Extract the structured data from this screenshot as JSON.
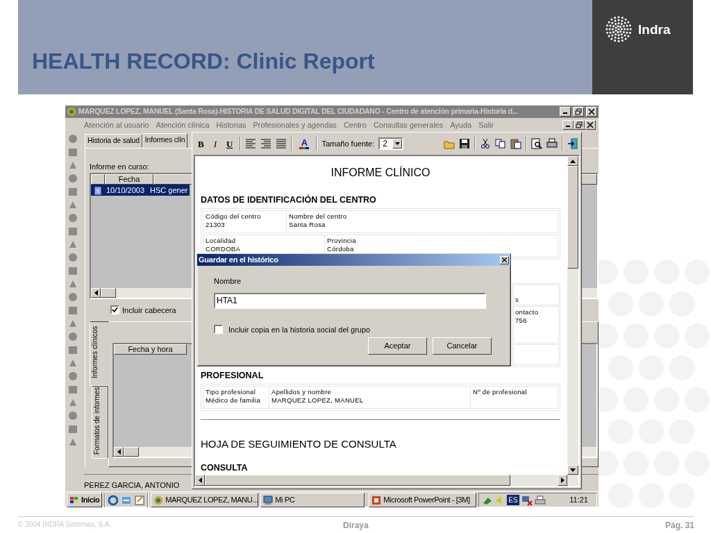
{
  "slide": {
    "title": "HEALTH RECORD: Clinic Report",
    "logo_text": "Indra"
  },
  "app_window": {
    "title": "MARQUEZ LOPEZ, MANUEL (Santa Rosa)-HISTORIA DE SALUD DIGITAL  DEL CIUDADANO - Centro de atención primaria-Historia d...",
    "active": false,
    "menu": [
      "Atención al usuario",
      "Atención clínica",
      "Historias",
      "Profesionales y agendas",
      "Centro",
      "Consultas generales",
      "Ayuda",
      "Salir"
    ],
    "left_panel": {
      "tabs": [
        {
          "label": "Historia de salud",
          "selected": false
        },
        {
          "label": "Informes clín",
          "selected": true
        }
      ],
      "current_label": "Informe en curso:",
      "table": {
        "columns": [
          "Fecha"
        ],
        "rows": [
          {
            "date": "10/10/2003",
            "description": "HSC gener",
            "selected": true
          }
        ]
      },
      "include_header": {
        "label": "Incluir cabecera",
        "checked": true
      },
      "side_tabs": [
        {
          "label": "Informes clínicos",
          "selected": true
        },
        {
          "label": "Formatos de informes",
          "selected": false
        }
      ],
      "list_columns": [
        "Fecha y hora"
      ],
      "patient": "PEREZ GARCIA, ANTONIO"
    }
  },
  "report_editor": {
    "format_buttons": [
      "B",
      "I",
      "U"
    ],
    "font_color_glyph": "A",
    "font_size_label": "Tamaño fuente:",
    "font_size": "2",
    "document": {
      "title": "INFORME CLÍNICO",
      "sections": [
        {
          "kind": "table",
          "heading": "DATOS DE IDENTIFICACIÓN DEL CENTRO",
          "rows": [
            [
              {
                "label": "Código del centro",
                "value": "21303"
              },
              {
                "label": "Nombre del centro",
                "value": "Santa Rosa"
              }
            ],
            [
              {
                "label": "Localidad",
                "value": "CORDOBA"
              },
              {
                "label": "Provincia",
                "value": "Córdoba"
              }
            ]
          ]
        },
        {
          "kind": "obscured",
          "cells": [
            {
              "lines": [
                "s"
              ]
            },
            {
              "lines": [
                "ontacto",
                "756"
              ]
            }
          ]
        },
        {
          "kind": "table",
          "heading": "PROFESIONAL",
          "rows": [
            [
              {
                "label": "Tipo profesional",
                "value": "Médico de familia"
              },
              {
                "label": "Apellidos y nombre",
                "value": "MARQUEZ LOPEZ, MANUEL"
              },
              {
                "label": "Nº de profesional"
              }
            ]
          ]
        },
        {
          "kind": "rule"
        },
        {
          "kind": "title",
          "text": "HOJA DE SEGUIMIENTO DE CONSULTA"
        },
        {
          "kind": "heading",
          "text": "CONSULTA"
        }
      ]
    }
  },
  "dialog": {
    "title": "Guardar en el histórico",
    "field_label": "Nombre",
    "name_value": "HTA1",
    "share_copy": {
      "label": "Incluir copia en la historia social del grupo",
      "checked": false
    },
    "buttons": [
      "Aceptar",
      "Cancelar"
    ]
  },
  "taskbar": {
    "start": "Inicio",
    "tasks": [
      {
        "kind": "app",
        "label": "MARQUEZ LOPEZ, MANU..."
      },
      {
        "kind": "computer",
        "label": "Mi PC"
      },
      {
        "kind": "powerpoint",
        "label": "Microsoft PowerPoint - [3M]"
      }
    ],
    "language": "ES",
    "clock": "11:21"
  },
  "footer": {
    "copyright": "© 2004 INDRA Sistemas, S.A.",
    "product": "Diraya",
    "page": "Pág. 31"
  }
}
